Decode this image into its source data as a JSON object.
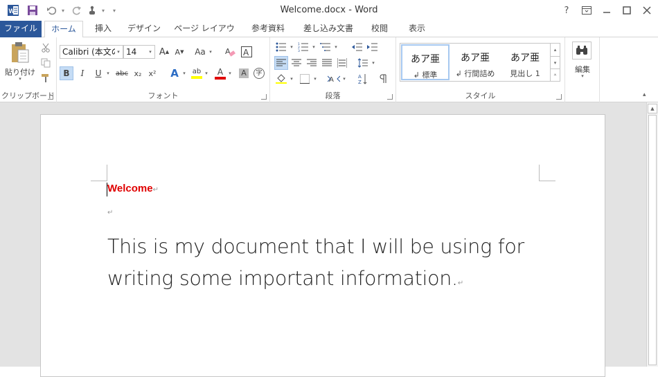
{
  "window": {
    "title": "Welcome.docx - Word",
    "help": "?",
    "ribbon_display": "▣",
    "minimize": "—",
    "maximize": "□",
    "close": "✕"
  },
  "qat": {
    "app_icon": "word-logo-icon",
    "app_letter": "W",
    "save": "save-icon",
    "undo": "undo-icon",
    "redo": "redo-icon",
    "touch": "touch-mode-icon",
    "customize": "▾"
  },
  "tabs": [
    {
      "label": "ファイル"
    },
    {
      "label": "ホーム"
    },
    {
      "label": "挿入"
    },
    {
      "label": "デザイン"
    },
    {
      "label": "ページ レイアウト"
    },
    {
      "label": "参考資料"
    },
    {
      "label": "差し込み文書"
    },
    {
      "label": "校閲"
    },
    {
      "label": "表示"
    }
  ],
  "clipboard": {
    "label": "クリップボード",
    "paste": "貼り付け"
  },
  "font": {
    "label": "フォント",
    "font_name": "Calibri (本文の",
    "font_size": "14",
    "grow": "A",
    "shrink": "A",
    "case": "Aa",
    "bold": "B",
    "italic": "I",
    "underline": "U",
    "strike": "abc",
    "sub": "x₂",
    "sup": "x²",
    "effects": "A",
    "highlight": "ab",
    "color": "A",
    "shade": "A",
    "enclose": "字",
    "highlight_color": "#ffff00",
    "font_color": "#e00000"
  },
  "paragraph": {
    "label": "段落"
  },
  "styles": {
    "label": "スタイル",
    "items": [
      {
        "sample": "あア亜",
        "name": "↲ 標準"
      },
      {
        "sample": "あア亜",
        "name": "↲ 行間詰め"
      },
      {
        "sample": "あア亜",
        "name": "見出し 1"
      }
    ]
  },
  "editing": {
    "label": "編集"
  },
  "document": {
    "heading": "Welcome",
    "para_mark": "↵",
    "body": "This is my document that I will be using for writing some important information.",
    "heading_color": "#e00000"
  },
  "colors": {
    "accent": "#2b579a"
  }
}
